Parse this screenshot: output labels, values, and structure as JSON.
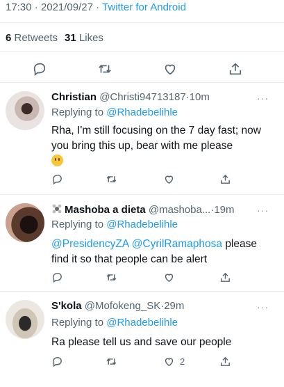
{
  "header": {
    "time": "17:30",
    "separator1": "·",
    "date": "2021/09/27",
    "separator2": "·",
    "client": "Twitter for Android"
  },
  "stats": {
    "retweets_count": "6",
    "retweets_label": "Retweets",
    "likes_count": "31",
    "likes_label": "Likes"
  },
  "main_actions": [
    "reply-icon",
    "retweet-icon",
    "like-icon",
    "share-icon"
  ],
  "replies": [
    {
      "name": "Christian",
      "handle": "@Christi94713187",
      "dot": "·",
      "time": "10m",
      "replying_prefix": "Replying to",
      "replying_to": "@Rhadebelihle",
      "text": "Rha, I'm still focusing on the 7 day fast; now you bring this up, bear with me please",
      "emoji": "grimacing-face",
      "like_count": ""
    },
    {
      "name": "Mashoba a dieta",
      "handle": "@mashoba...",
      "dot": "·",
      "time": "19m",
      "replying_prefix": "Replying to",
      "replying_to": "@Rhadebelihle",
      "mention1": "@PresidencyZA",
      "mention2": "@CyrilRamaphosa",
      "text_after": "please find it so that people can be alert",
      "like_count": ""
    },
    {
      "name": "S'kola",
      "handle": "@Mofokeng_SK",
      "dot": "·",
      "time": "29m",
      "replying_prefix": "Replying to",
      "replying_to": "@Rhadebelihle",
      "text": "Ra please tell us and save our people",
      "like_count": "2"
    }
  ],
  "more_label": "···",
  "colors": {
    "accent": "#1d9bf0",
    "secondary_text": "#536471",
    "divider": "#e6ecf0"
  }
}
